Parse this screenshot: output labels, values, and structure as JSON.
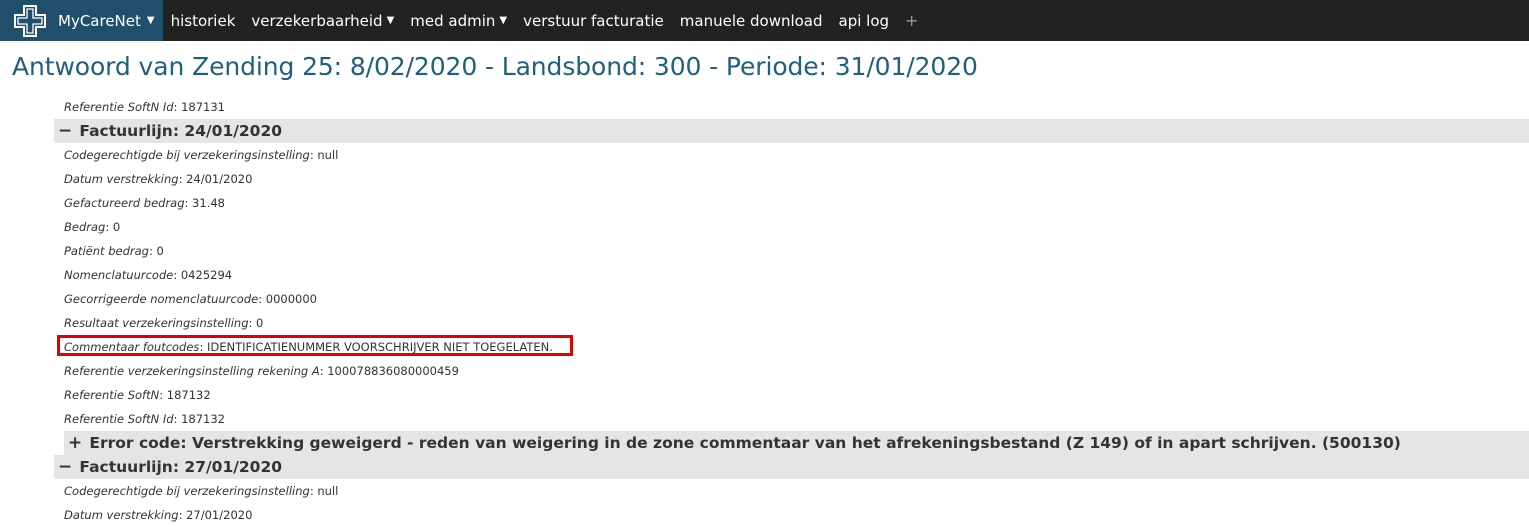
{
  "nav": {
    "brand": "MyCareNet",
    "items": [
      {
        "label": "historiek",
        "dropdown": false
      },
      {
        "label": "verzekerbaarheid",
        "dropdown": true
      },
      {
        "label": "med admin",
        "dropdown": true
      },
      {
        "label": "verstuur facturatie",
        "dropdown": false
      },
      {
        "label": "manuele download",
        "dropdown": false
      },
      {
        "label": "api log",
        "dropdown": false
      }
    ],
    "plus": "+"
  },
  "page": {
    "title": "Antwoord van Zending 25: 8/02/2020 - Landsbond: 300 - Periode: 31/01/2020"
  },
  "top_line": {
    "label": "Referentie SoftN Id",
    "value": "187131"
  },
  "sections": [
    {
      "title": "Factuurlijn: 24/01/2020",
      "toggle": "−",
      "fields": [
        {
          "label": "Codegerechtigde bij verzekeringsinstelling",
          "value": "null"
        },
        {
          "label": "Datum verstrekking",
          "value": "24/01/2020"
        },
        {
          "label": "Gefactureerd bedrag",
          "value": "31.48"
        },
        {
          "label": "Bedrag",
          "value": "0"
        },
        {
          "label": "Patiënt bedrag",
          "value": "0"
        },
        {
          "label": "Nomenclatuurcode",
          "value": "0425294"
        },
        {
          "label": "Gecorrigeerde nomenclatuurcode",
          "value": "0000000"
        },
        {
          "label": "Resultaat verzekeringsinstelling",
          "value": "0"
        },
        {
          "label": "Commentaar foutcodes",
          "value": "IDENTIFICATIENUMMER VOORSCHRIJVER NIET TOEGELATEN."
        },
        {
          "label": "Referentie verzekeringsinstelling rekening A",
          "value": "100078836080000459"
        },
        {
          "label": "Referentie SoftN",
          "value": "187132"
        },
        {
          "label": "Referentie SoftN Id",
          "value": "187132"
        }
      ],
      "sub_section": {
        "toggle": "+",
        "title": "Error code: Verstrekking geweigerd - reden van weigering in de zone commentaar van het afrekeningsbestand (Z 149) of in apart schrijven. (500130)"
      }
    },
    {
      "title": "Factuurlijn: 27/01/2020",
      "toggle": "−",
      "fields": [
        {
          "label": "Codegerechtigde bij verzekeringsinstelling",
          "value": "null"
        },
        {
          "label": "Datum verstrekking",
          "value": "27/01/2020"
        }
      ]
    }
  ],
  "colors": {
    "navbar": "#222222",
    "brand": "#1f4f6b",
    "title": "#1f5f7f",
    "section_bg": "#e5e5e5",
    "highlight_box": "#e00000"
  }
}
